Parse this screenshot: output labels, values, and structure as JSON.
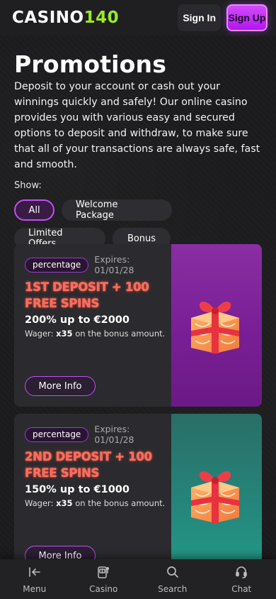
{
  "header": {
    "logo_text": "CASINO",
    "logo_accent": "140",
    "sign_in_label": "Sign In",
    "sign_up_label": "Sign Up"
  },
  "main": {
    "title": "Promotions",
    "intro": "Deposit to your account or cash out your winnings quickly and safely! Our online casino provides you with various easy and secured options to deposit and withdraw, to make sure that all of your transactions are always safe, fast and smooth.",
    "show_label": "Show:",
    "filters": [
      {
        "label": "All",
        "active": true
      },
      {
        "label": "Welcome Package",
        "active": false
      },
      {
        "label": "Limited Offers",
        "active": false
      },
      {
        "label": "Bonus",
        "active": false
      }
    ]
  },
  "promos": [
    {
      "tag": "percentage",
      "expires": "Expires: 01/01/28",
      "title_line1": "1ST DEPOSIT + 100",
      "title_line2": "FREE SPINS",
      "amount": "200% up to €2000",
      "wager_prefix": "Wager: ",
      "wager_value": "x35",
      "wager_suffix": " on the bonus amount.",
      "button": "More Info",
      "image_icon": "gift-box-icon",
      "panel_color": "#7a1f97"
    },
    {
      "tag": "percentage",
      "expires": "Expires: 01/01/28",
      "title_line1": "2ND DEPOSIT + 100",
      "title_line2": "FREE SPINS",
      "amount": "150% up to €1000",
      "wager_prefix": "Wager: ",
      "wager_value": "x35",
      "wager_suffix": " on the bonus amount.",
      "button": "More Info",
      "image_icon": "gift-box-icon",
      "panel_color": "#25857a"
    }
  ],
  "bottom_nav": [
    {
      "label": "Menu",
      "icon": "menu-arrow-icon"
    },
    {
      "label": "Casino",
      "icon": "slot-machine-icon"
    },
    {
      "label": "Search",
      "icon": "search-icon"
    },
    {
      "label": "Chat",
      "icon": "headset-icon"
    }
  ],
  "colors": {
    "accent_purple": "#c34ef0",
    "logo_green": "#9ce82a",
    "promo_title": "#ff6b5a",
    "background": "#1b1b1d"
  }
}
